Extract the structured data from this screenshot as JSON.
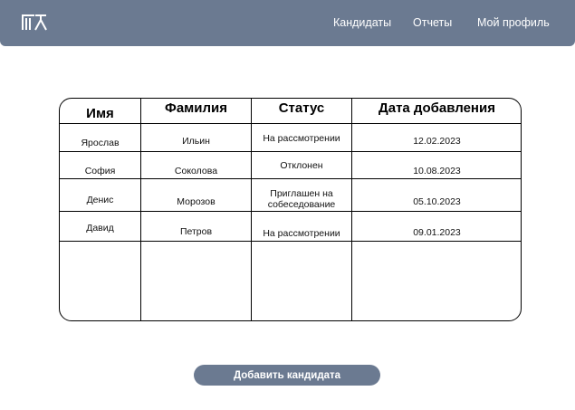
{
  "nav": {
    "candidates": "Кандидаты",
    "reports": "Отчеты",
    "profile": "Мой профиль"
  },
  "table": {
    "headers": [
      "Имя",
      "Фамилия",
      "Статус",
      "Дата добавления"
    ],
    "rows": [
      {
        "first_name": "Ярослав",
        "last_name": "Ильин",
        "status": "На рассмотрении",
        "date": "12.02.2023"
      },
      {
        "first_name": "София",
        "last_name": "Соколова",
        "status": "Отклонен",
        "date": "10.08.2023"
      },
      {
        "first_name": "Денис",
        "last_name": "Морозов",
        "status": "Приглашен на собеседование",
        "date": "05.10.2023"
      },
      {
        "first_name": "Давид",
        "last_name": "Петров",
        "status": "На рассмотрении",
        "date": "09.01.2023"
      }
    ]
  },
  "actions": {
    "add_candidate": "Добавить кандидата"
  },
  "colors": {
    "header_bar": "#6b7a91",
    "button": "#6b7a91"
  },
  "icons": {
    "logo": "app-logo-icon"
  }
}
